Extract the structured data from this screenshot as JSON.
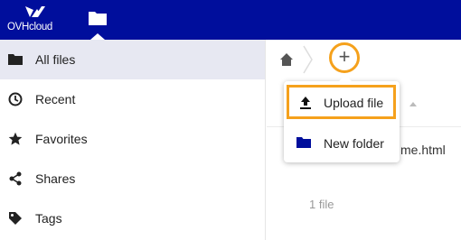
{
  "header": {
    "logo_text": "OVHcloud",
    "app_icon": "folder-icon",
    "brand_color": "#000e9c"
  },
  "sidebar": {
    "items": [
      {
        "label": "All files",
        "icon": "folder-icon",
        "active": true
      },
      {
        "label": "Recent",
        "icon": "clock-icon",
        "active": false
      },
      {
        "label": "Favorites",
        "icon": "star-icon",
        "active": false
      },
      {
        "label": "Shares",
        "icon": "share-icon",
        "active": false
      },
      {
        "label": "Tags",
        "icon": "tag-icon",
        "active": false
      }
    ]
  },
  "breadcrumb": {
    "home_icon": "home-icon",
    "add_button": "+"
  },
  "new_menu": {
    "items": [
      {
        "label": "Upload file",
        "icon": "upload-icon",
        "highlighted": true
      },
      {
        "label": "New folder",
        "icon": "folder-icon",
        "highlighted": false
      }
    ]
  },
  "file_list": {
    "visible_name_fragment": "me.html",
    "summary": "1 file"
  },
  "highlight_color": "#f5a11c"
}
